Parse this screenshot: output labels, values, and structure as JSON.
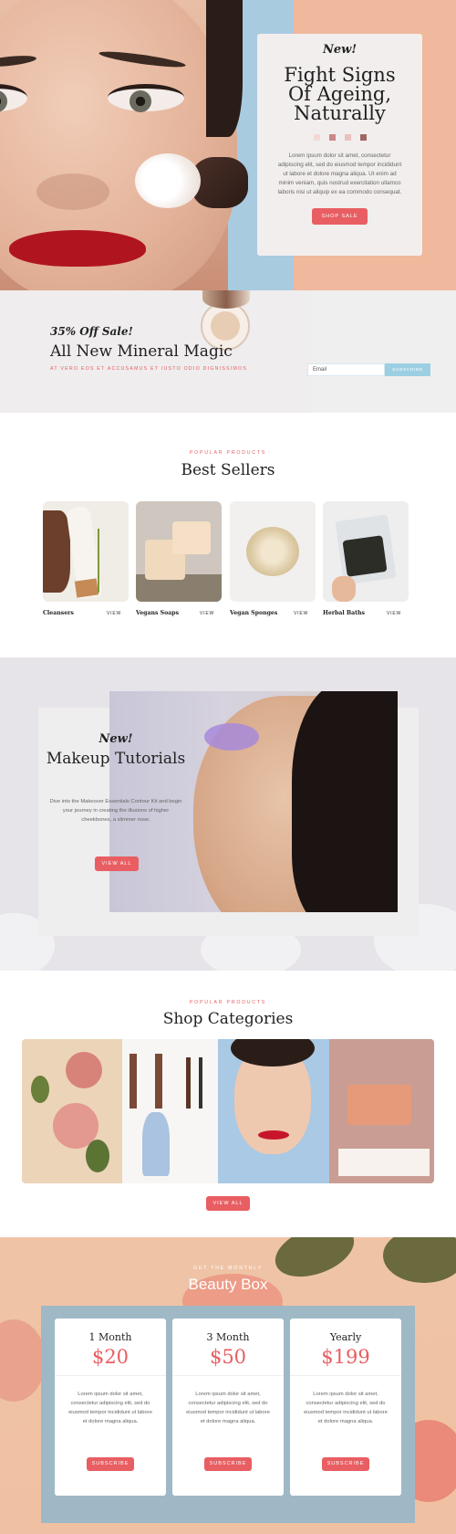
{
  "hero": {
    "kicker": "New!",
    "title": "Fight Signs Of Ageing, Naturally",
    "body": "Lorem ipsum dolor sit amet, consectetur adipiscing elit, sed do eiusmod tempor incididunt ut labore et dolore magna aliqua. Ut enim ad minim veniam, quis nostrud exercitation ullamco laboris nisi ut aliquip ex ea commodo consequat.",
    "swatches": [
      "#f3d9d6",
      "#c9888a",
      "#e9c1bf",
      "#9f6664"
    ],
    "button": "SHOP SALE"
  },
  "promo": {
    "sale": "35% Off Sale!",
    "title": "All New Mineral Magic",
    "subtitle": "AT VERO EOS ET ACCUSAMUS ET IUSTO ODIO DIGNISSIMOS",
    "email_placeholder": "Email",
    "subscribe": "SUBSCRIBE"
  },
  "best_sellers": {
    "kicker": "POPULAR PRODUCTS",
    "title": "Best Sellers",
    "products": [
      {
        "name": "Cleansers",
        "link": "VIEW"
      },
      {
        "name": "Vegans Soaps",
        "link": "VIEW"
      },
      {
        "name": "Vegan Sponges",
        "link": "VIEW"
      },
      {
        "name": "Herbal Baths",
        "link": "VIEW"
      }
    ]
  },
  "tutorials": {
    "kicker": "New!",
    "title": "Makeup Tutorials",
    "body": "Dive into the Makeover Essentials Contour Kit and begin your journey in creating the illusions of higher cheekbones, a slimmer nose.",
    "button": "VIEW ALL"
  },
  "categories": {
    "kicker": "POPULAR PRODUCTS",
    "title": "Shop Categories",
    "button": "VIEW ALL"
  },
  "beauty_box": {
    "kicker": "GET THE MONTHLY",
    "title": "Beauty Box",
    "plans": [
      {
        "name": "1 Month",
        "price": "$20",
        "body": "Lorem ipsum dolor sit amet, consectetur adipiscing elit, sed do eiusmod tempor incididunt ut labore et dolore magna aliqua.",
        "button": "SUBSCRIBE"
      },
      {
        "name": "3 Month",
        "price": "$50",
        "body": "Lorem ipsum dolor sit amet, consectetur adipiscing elit, sed do eiusmod tempor incididunt ut labore et dolore magna aliqua.",
        "button": "SUBSCRIBE"
      },
      {
        "name": "Yearly",
        "price": "$199",
        "body": "Lorem ipsum dolor sit amet, consectetur adipiscing elit, sed do eiusmod tempor incididunt ut labore et dolore magna aliqua.",
        "button": "SUBSCRIBE"
      }
    ]
  },
  "colors": {
    "accent": "#e85e62",
    "peach": "#f0b89c",
    "sky": "#9dcfe3",
    "panel": "#9fb8c6"
  }
}
